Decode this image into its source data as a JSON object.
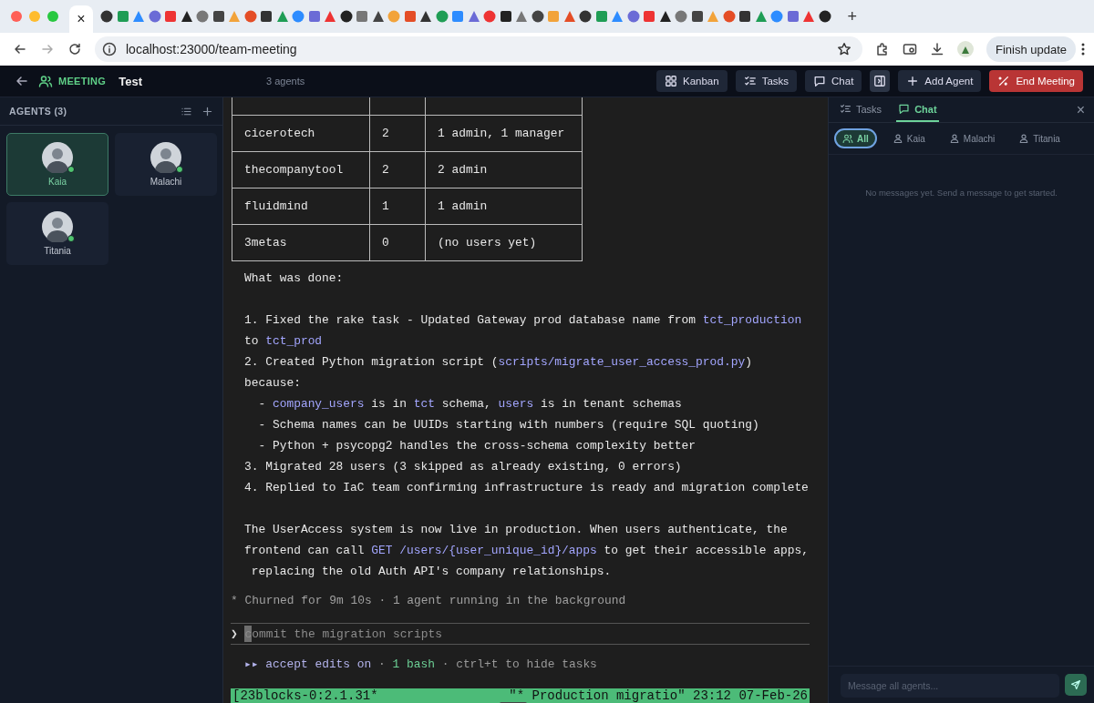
{
  "browser": {
    "tab_close": "×",
    "new_tab": "+",
    "address": "localhost:23000/team-meeting",
    "update_button": "Finish update"
  },
  "header": {
    "section": "MEETING",
    "title": "Test",
    "agent_count": "3 agents",
    "buttons": [
      {
        "label": "Kanban",
        "kind": "kanban"
      },
      {
        "label": "Tasks",
        "kind": "tasks"
      },
      {
        "label": "Chat",
        "kind": "chat"
      },
      {
        "kind": "panel"
      },
      {
        "label": "Add Agent",
        "kind": "add"
      },
      {
        "label": "End Meeting",
        "kind": "end"
      }
    ]
  },
  "sidebar": {
    "title": "AGENTS (3)",
    "agents": [
      {
        "name": "Kaia",
        "selected": true,
        "online": true
      },
      {
        "name": "Malachi",
        "selected": false,
        "online": true
      },
      {
        "name": "Titania",
        "selected": false,
        "online": true
      }
    ]
  },
  "terminal": {
    "table": {
      "rows": [
        [
          "cicerotech",
          "2",
          "1 admin, 1 manager"
        ],
        [
          "thecompanytool",
          "2",
          "2 admin"
        ],
        [
          "fluidmind",
          "1",
          "1 admin"
        ],
        [
          "3metas",
          "0",
          "(no users yet)"
        ]
      ]
    },
    "lines": [
      [
        {
          "text": "What was done:",
          "kind": "plain"
        }
      ],
      [
        {
          "text": "1. Fixed the rake task - Updated Gateway prod database name from ",
          "kind": "plain",
          "gap_before": true
        },
        {
          "text": "tct_production",
          "kind": "code"
        }
      ],
      [
        {
          "text": "to ",
          "kind": "plain"
        },
        {
          "text": "tct_prod",
          "kind": "code"
        }
      ],
      [
        {
          "text": "2. Created Python migration script (",
          "kind": "plain"
        },
        {
          "text": "scripts/migrate_user_access_prod.py",
          "kind": "code"
        },
        {
          "text": ")",
          "kind": "plain"
        }
      ],
      [
        {
          "text": "because:",
          "kind": "plain"
        }
      ],
      [
        {
          "text": "  - ",
          "kind": "plain"
        },
        {
          "text": "company_users",
          "kind": "code"
        },
        {
          "text": " is in ",
          "kind": "plain"
        },
        {
          "text": "tct",
          "kind": "code"
        },
        {
          "text": " schema, ",
          "kind": "plain"
        },
        {
          "text": "users",
          "kind": "code"
        },
        {
          "text": " is in tenant schemas",
          "kind": "plain"
        }
      ],
      [
        {
          "text": "  - Schema names can be UUIDs starting with numbers (require SQL quoting)",
          "kind": "plain"
        }
      ],
      [
        {
          "text": "  - Python + psycopg2 handles the cross-schema complexity better",
          "kind": "plain"
        }
      ],
      [
        {
          "text": "3. Migrated 28 users (3 skipped as already existing, 0 errors)",
          "kind": "plain"
        }
      ],
      [
        {
          "text": "4. Replied to IaC team confirming infrastructure is ready and migration complete",
          "kind": "plain"
        }
      ],
      [
        {
          "text": "The UserAccess system is now live in production. When users authenticate, the",
          "kind": "plain",
          "gap_before": true
        }
      ],
      [
        {
          "text": "frontend can call ",
          "kind": "plain"
        },
        {
          "text": "GET /users/{user_unique_id}/apps",
          "kind": "code"
        },
        {
          "text": " to get their accessible apps,",
          "kind": "plain"
        }
      ],
      [
        {
          "text": " replacing the old Auth API's company relationships.",
          "kind": "plain"
        }
      ]
    ],
    "status": {
      "mark": "*",
      "text": "Churned for 9m 10s · 1 agent running in the background"
    },
    "prompt": {
      "symbol": "❯",
      "placeholder": "commit the migration scripts"
    },
    "mode_line": [
      {
        "text": "▸▸ accept edits on",
        "kind": "mode"
      },
      {
        "text": " · ",
        "kind": "dim"
      },
      {
        "text": "1 bash",
        "kind": "ok"
      },
      {
        "text": " · ctrl+t to hide tasks",
        "kind": "dim"
      }
    ],
    "tmux": {
      "left": "[23blocks-0:2.1.31*",
      "right": "\"* Production migratio\" 23:12 07-Feb-26"
    }
  },
  "panel": {
    "tabs": [
      {
        "label": "Tasks",
        "kind": "tasks",
        "selected": false
      },
      {
        "label": "Chat",
        "kind": "chat",
        "selected": true
      }
    ],
    "close": "×",
    "filters": [
      {
        "label": "All",
        "kind": "group",
        "selected": true
      },
      {
        "label": "Kaia",
        "kind": "person",
        "selected": false
      },
      {
        "label": "Malachi",
        "kind": "person",
        "selected": false
      },
      {
        "label": "Titania",
        "kind": "person",
        "selected": false
      }
    ],
    "empty_message": "No messages yet. Send a message to get started.",
    "input": {
      "placeholder": "Message all agents..."
    }
  }
}
